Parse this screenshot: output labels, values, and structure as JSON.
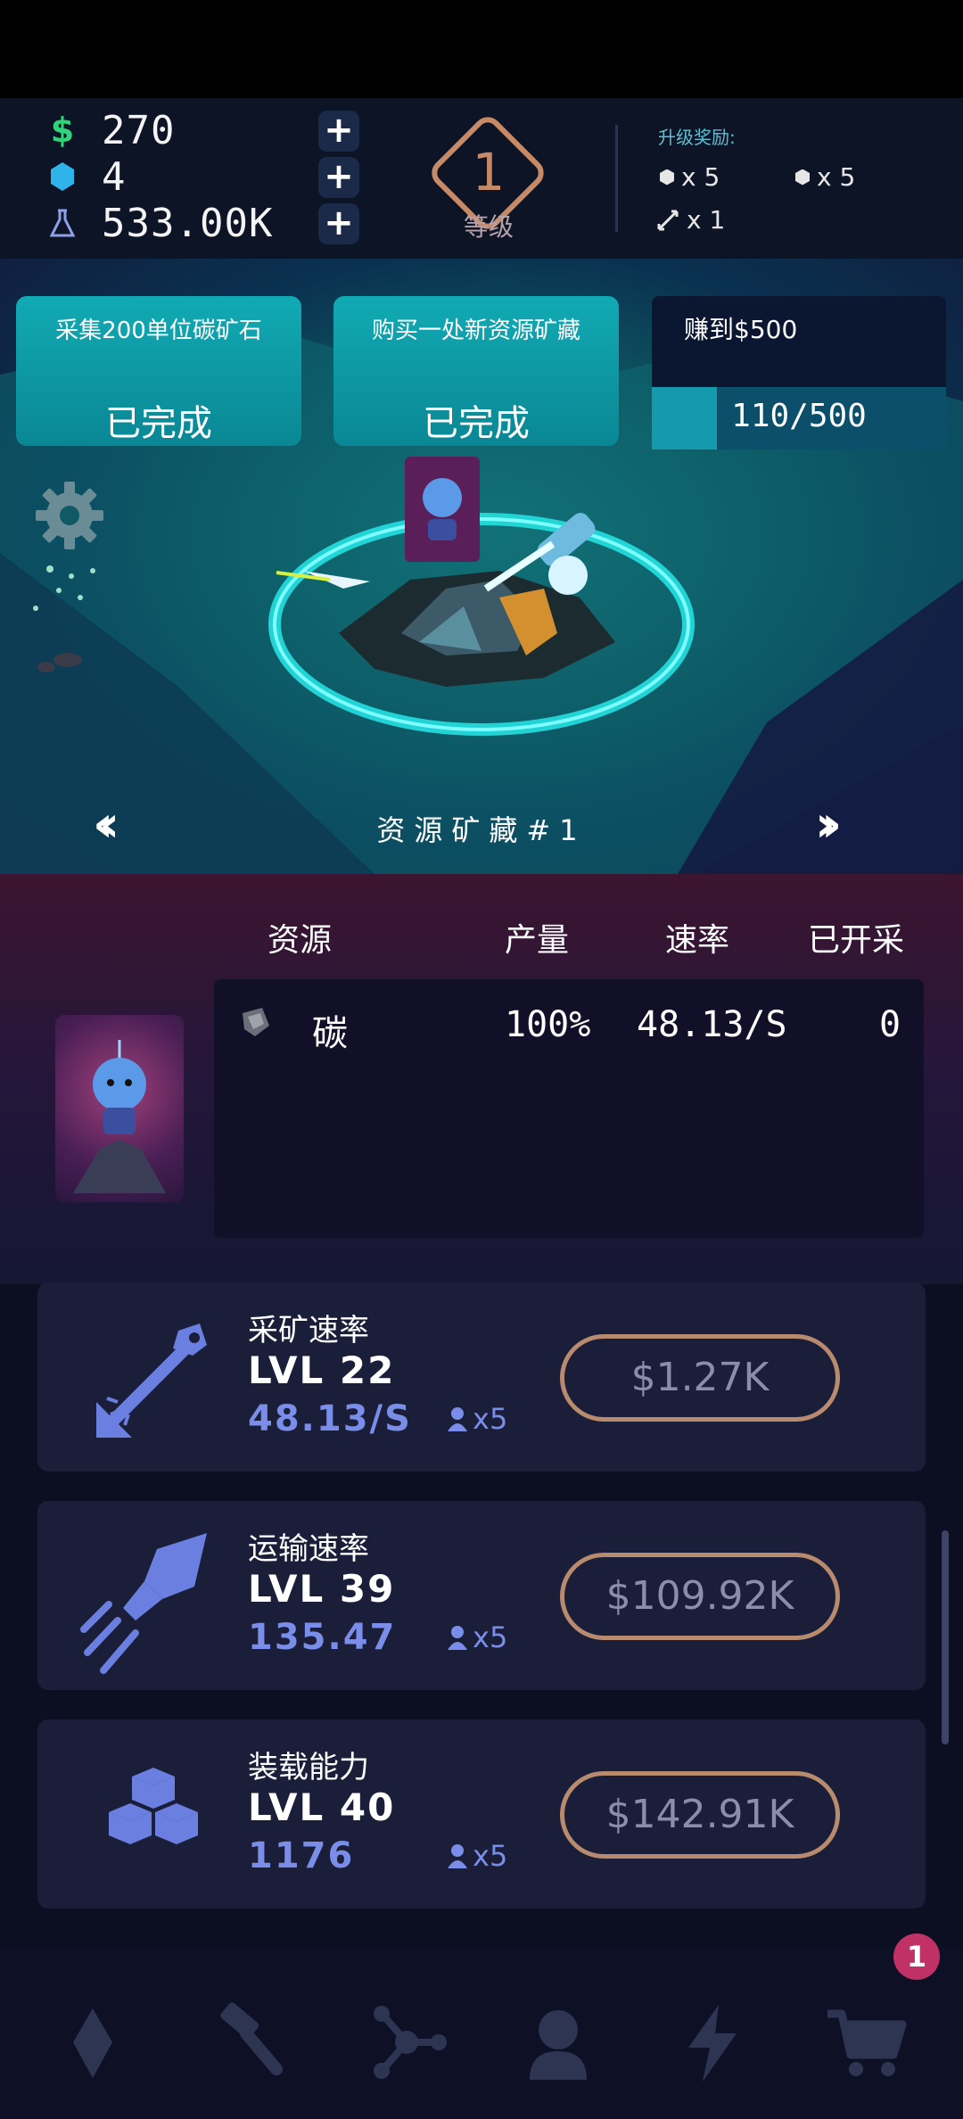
{
  "currencies": [
    {
      "icon": "dollar-icon",
      "value": "270"
    },
    {
      "icon": "gem-icon",
      "value": "4"
    },
    {
      "icon": "flask-icon",
      "value": "533.00K"
    }
  ],
  "level": {
    "number": "1",
    "label": "等级"
  },
  "rewards": {
    "title": "升级奖励:",
    "items": [
      "x 5",
      "x 5",
      "x 1"
    ]
  },
  "quests": [
    {
      "title": "采集200单位碳矿石",
      "status": "已完成"
    },
    {
      "title": "购买一处新资源矿藏",
      "status": "已完成"
    },
    {
      "title": "赚到$500",
      "progress_text": "110/500",
      "progress": 0.22
    }
  ],
  "deposit": {
    "name": "资源矿藏#1"
  },
  "table": {
    "headers": [
      "资源",
      "产量",
      "速率",
      "已开采"
    ],
    "rows": [
      {
        "resource": "碳",
        "output": "100%",
        "rate": "48.13/S",
        "mined": "0"
      }
    ]
  },
  "upgrades": [
    {
      "name": "采矿速率",
      "level": "LVL 22",
      "rate": "48.13/S",
      "mult": "x5",
      "price": "$1.27K"
    },
    {
      "name": "运输速率",
      "level": "LVL 39",
      "rate": "135.47",
      "mult": "x5",
      "price": "$109.92K"
    },
    {
      "name": "装载能力",
      "level": "LVL 40",
      "rate": "1176",
      "mult": "x5",
      "price": "$142.91K"
    }
  ],
  "nav": {
    "badge": "1"
  },
  "colors": {
    "accent": "#11aab4",
    "price_border": "#b88a6e",
    "stat_blue": "#7a8de8"
  }
}
